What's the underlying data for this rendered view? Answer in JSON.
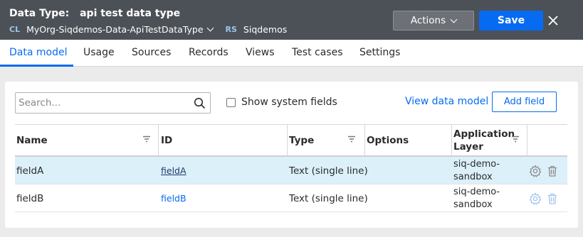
{
  "header": {
    "title_label": "Data Type:",
    "title_value": "api test data type",
    "class_tag": "CL",
    "class_name": "MyOrg-Siqdemos-Data-ApiTestDataType",
    "ruleset_tag": "RS",
    "ruleset_name": "Siqdemos",
    "actions_label": "Actions",
    "save_label": "Save",
    "close_icon": "close-icon"
  },
  "tabs": [
    {
      "label": "Data model",
      "active": true
    },
    {
      "label": "Usage"
    },
    {
      "label": "Sources"
    },
    {
      "label": "Records"
    },
    {
      "label": "Views"
    },
    {
      "label": "Test cases"
    },
    {
      "label": "Settings"
    }
  ],
  "toolbar": {
    "search_placeholder": "Search...",
    "show_system_fields_label": "Show system fields",
    "view_data_model_label": "View data model",
    "add_field_label": "Add field"
  },
  "table": {
    "columns": [
      "Name",
      "ID",
      "Type",
      "Options",
      "Application Layer"
    ],
    "rows": [
      {
        "name": "fieldA",
        "id": "fieldA",
        "type": "Text (single line)",
        "options": "",
        "layer": "siq-demo-sandbox",
        "selected": true
      },
      {
        "name": "fieldB",
        "id": "fieldB",
        "type": "Text (single line)",
        "options": "",
        "layer": "siq-demo-sandbox",
        "selected": false
      }
    ]
  },
  "colors": {
    "accent": "#076bf2",
    "header_bg": "#4c5157",
    "selected_row": "#dcf0fa"
  }
}
